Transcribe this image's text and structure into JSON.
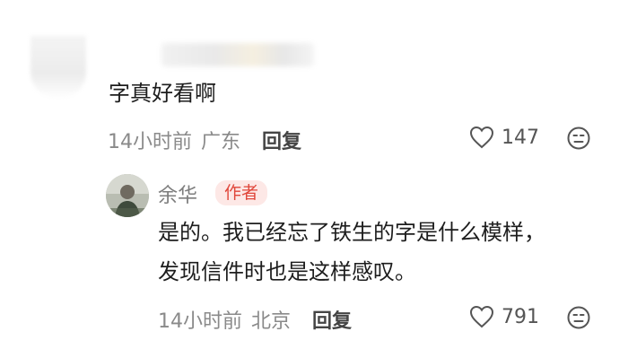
{
  "comment": {
    "text": "字真好看啊",
    "time": "14小时前",
    "location": "广东",
    "reply_label": "回复",
    "likes": "147"
  },
  "reply": {
    "author": "余华",
    "badge": "作者",
    "text_line1": "是的。我已经忘了铁生的字是什么模样，",
    "text_line2": "发现信件时也是这样感叹。",
    "time": "14小时前",
    "location": "北京",
    "reply_label": "回复",
    "likes": "791"
  },
  "icons": {
    "like": "heart-outline-icon",
    "dislike": "unhappy-face-icon"
  },
  "colors": {
    "badge_bg": "#fde8e6",
    "badge_text": "#e0463a",
    "meta_text": "#8a8a8a"
  }
}
